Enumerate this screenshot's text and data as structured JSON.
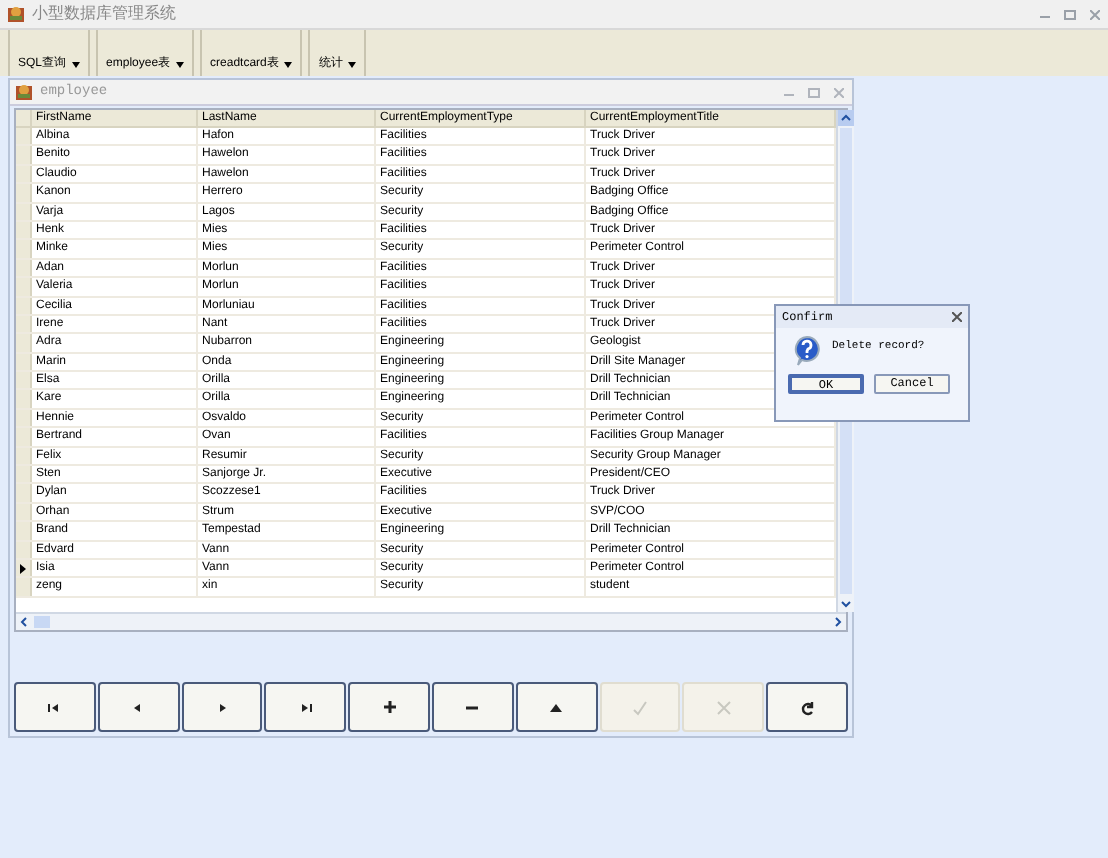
{
  "window": {
    "title": "小型数据库管理系统"
  },
  "toolbar": [
    {
      "label": "SQL查询"
    },
    {
      "label": "employee表"
    },
    {
      "label": "creadtcard表"
    },
    {
      "label": "统计"
    }
  ],
  "child_window": {
    "title": "employee"
  },
  "table": {
    "columns": [
      "FirstName",
      "LastName",
      "CurrentEmploymentType",
      "CurrentEmploymentTitle"
    ],
    "rows": [
      {
        "cells": [
          "Albina",
          "Hafon",
          "Facilities",
          "Truck Driver"
        ],
        "current": false
      },
      {
        "cells": [
          "Benito",
          "Hawelon",
          "Facilities",
          "Truck Driver"
        ],
        "current": false
      },
      {
        "cells": [
          "Claudio",
          "Hawelon",
          "Facilities",
          "Truck Driver"
        ],
        "current": false
      },
      {
        "cells": [
          "Kanon",
          "Herrero",
          "Security",
          "Badging Office"
        ],
        "current": false
      },
      {
        "cells": [
          "Varja",
          "Lagos",
          "Security",
          "Badging Office"
        ],
        "current": false
      },
      {
        "cells": [
          "Henk",
          "Mies",
          "Facilities",
          "Truck Driver"
        ],
        "current": false
      },
      {
        "cells": [
          "Minke",
          "Mies",
          "Security",
          "Perimeter Control"
        ],
        "current": false
      },
      {
        "cells": [
          "Adan",
          "Morlun",
          "Facilities",
          "Truck Driver"
        ],
        "current": false
      },
      {
        "cells": [
          "Valeria",
          "Morlun",
          "Facilities",
          "Truck Driver"
        ],
        "current": false
      },
      {
        "cells": [
          "Cecilia",
          "Morluniau",
          "Facilities",
          "Truck Driver"
        ],
        "current": false
      },
      {
        "cells": [
          "Irene",
          "Nant",
          "Facilities",
          "Truck Driver"
        ],
        "current": false
      },
      {
        "cells": [
          "Adra",
          "Nubarron",
          "Engineering",
          "Geologist"
        ],
        "current": false
      },
      {
        "cells": [
          "Marin",
          "Onda",
          "Engineering",
          "Drill Site Manager"
        ],
        "current": false
      },
      {
        "cells": [
          "Elsa",
          "Orilla",
          "Engineering",
          "Drill Technician"
        ],
        "current": false
      },
      {
        "cells": [
          "Kare",
          "Orilla",
          "Engineering",
          "Drill Technician"
        ],
        "current": false
      },
      {
        "cells": [
          "Hennie",
          "Osvaldo",
          "Security",
          "Perimeter Control"
        ],
        "current": false
      },
      {
        "cells": [
          "Bertrand",
          "Ovan",
          "Facilities",
          "Facilities Group Manager"
        ],
        "current": false
      },
      {
        "cells": [
          "Felix",
          "Resumir",
          "Security",
          "Security Group Manager"
        ],
        "current": false
      },
      {
        "cells": [
          "Sten",
          "Sanjorge Jr.",
          "Executive",
          "President/CEO"
        ],
        "current": false
      },
      {
        "cells": [
          "Dylan",
          "Scozzese1",
          "Facilities",
          "Truck Driver"
        ],
        "current": false
      },
      {
        "cells": [
          "Orhan",
          "Strum",
          "Executive",
          "SVP/COO"
        ],
        "current": false
      },
      {
        "cells": [
          "Brand",
          "Tempestad",
          "Engineering",
          "Drill Technician"
        ],
        "current": false
      },
      {
        "cells": [
          "Edvard",
          "Vann",
          "Security",
          "Perimeter Control"
        ],
        "current": false
      },
      {
        "cells": [
          "Isia",
          "Vann",
          "Security",
          "Perimeter Control"
        ],
        "current": true
      },
      {
        "cells": [
          "zeng",
          "xin",
          "Security",
          "student"
        ],
        "current": false
      }
    ]
  },
  "navigator": [
    {
      "kind": "first",
      "disabled": false
    },
    {
      "kind": "prior",
      "disabled": false
    },
    {
      "kind": "next",
      "disabled": false
    },
    {
      "kind": "last",
      "disabled": false
    },
    {
      "kind": "insert",
      "disabled": false
    },
    {
      "kind": "delete",
      "disabled": false
    },
    {
      "kind": "edit",
      "disabled": false
    },
    {
      "kind": "post",
      "disabled": true
    },
    {
      "kind": "cancel",
      "disabled": true
    },
    {
      "kind": "refresh",
      "disabled": false
    }
  ],
  "dialog": {
    "title": "Confirm",
    "message": "Delete record?",
    "buttons": [
      {
        "label": "OK",
        "selected": true
      },
      {
        "label": "Cancel",
        "selected": false
      }
    ]
  }
}
